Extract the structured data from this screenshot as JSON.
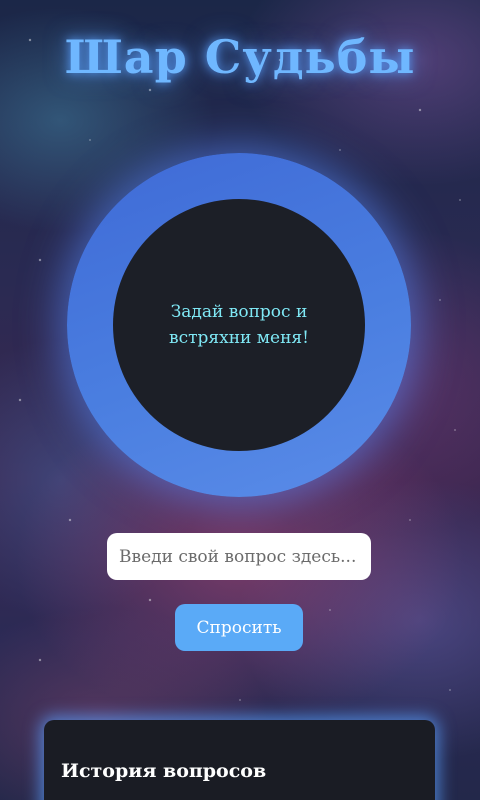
{
  "app": {
    "title": "Шар Судьбы"
  },
  "ball": {
    "message": "Задай вопрос и встряхни меня!"
  },
  "question": {
    "placeholder": "Введи свой вопрос здесь...",
    "value": ""
  },
  "ask_button": {
    "label": "Спросить"
  },
  "history": {
    "title": "История вопросов"
  },
  "colors": {
    "title": "#6fb7ff",
    "ball_ring": "#4a7ee0",
    "ball_core": "#1c1f27",
    "ball_text": "#7fe8f5",
    "button": "#5aaaf7",
    "panel": "#1a1c24"
  }
}
